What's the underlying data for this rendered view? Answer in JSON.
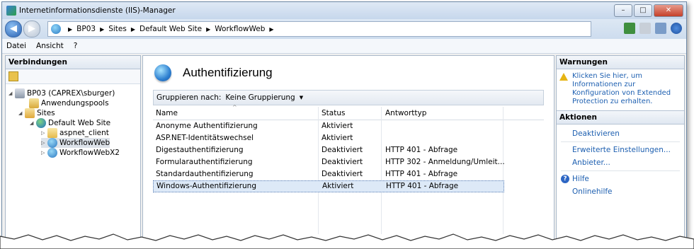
{
  "window": {
    "title": "Internetinformationsdienste (IIS)-Manager",
    "buttons": [
      "–",
      "□",
      "✕"
    ]
  },
  "address": {
    "crumbs": [
      "BP03",
      "Sites",
      "Default Web Site",
      "WorkflowWeb"
    ],
    "separator": "▶"
  },
  "menu": {
    "items": [
      "Datei",
      "Ansicht",
      "?"
    ]
  },
  "left_panel": {
    "title": "Verbindungen",
    "tree": [
      {
        "label": "BP03 (CAPREX\\sburger)",
        "toggle": "◢",
        "icon": "server-icon"
      },
      {
        "label": "Anwendungspools",
        "toggle": "",
        "icon": "app-pool-icon"
      },
      {
        "label": "Sites",
        "toggle": "◢",
        "icon": "sites-icon"
      },
      {
        "label": "Default Web Site",
        "toggle": "◢",
        "icon": "website-icon"
      },
      {
        "label": "aspnet_client",
        "toggle": "▷",
        "icon": "folder-icon"
      },
      {
        "label": "WorkflowWeb",
        "toggle": "▷",
        "icon": "application-icon"
      },
      {
        "label": "WorkflowWebX2",
        "toggle": "▷",
        "icon": "application-icon"
      }
    ]
  },
  "center": {
    "title": "Authentifizierung",
    "group_label": "Gruppieren nach:",
    "group_value": "Keine Gruppierung",
    "columns": [
      "Name",
      "Status",
      "Antworttyp"
    ],
    "sort_glyph": "^",
    "rows": [
      {
        "name": "Anonyme Authentifizierung",
        "status": "Aktiviert",
        "type": ""
      },
      {
        "name": "ASP.NET-Identitätswechsel",
        "status": "Aktiviert",
        "type": ""
      },
      {
        "name": "Digestauthentifizierung",
        "status": "Deaktiviert",
        "type": "HTTP 401 - Abfrage"
      },
      {
        "name": "Formularauthentifizierung",
        "status": "Deaktiviert",
        "type": "HTTP 302 - Anmeldung/Umleit..."
      },
      {
        "name": "Standardauthentifizierung",
        "status": "Deaktiviert",
        "type": "HTTP 401 - Abfrage"
      },
      {
        "name": "Windows-Authentifizierung",
        "status": "Aktiviert",
        "type": "HTTP 401 - Abfrage"
      }
    ],
    "selected_row": 5
  },
  "right_panel": {
    "warnings_title": "Warnungen",
    "warning_text": "Klicken Sie hier, um Informationen zur Konfiguration von Extended Protection zu erhalten.",
    "actions_title": "Aktionen",
    "actions": {
      "deactivate": "Deaktivieren",
      "advanced": "Erweiterte Einstellungen...",
      "providers": "Anbieter...",
      "help": "Hilfe",
      "online_help": "Onlinehilfe"
    }
  }
}
